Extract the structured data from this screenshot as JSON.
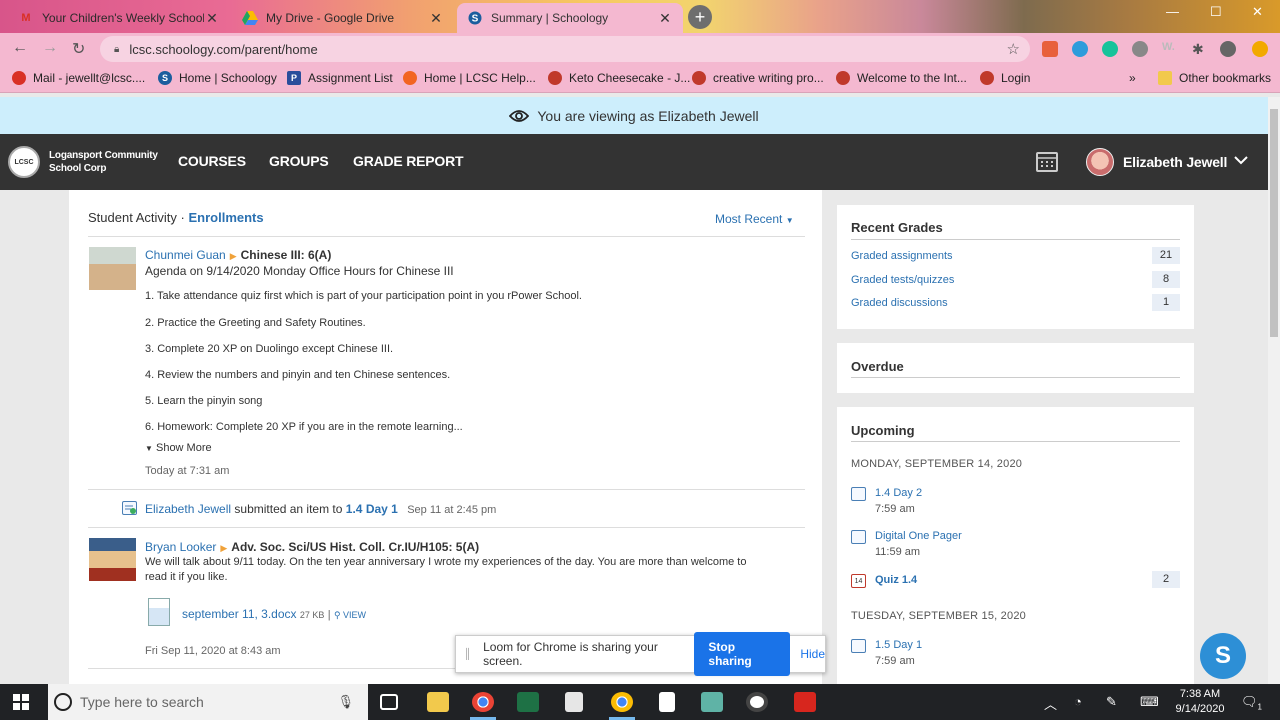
{
  "browser": {
    "tabs": [
      {
        "title": "Your Children's Weekly Schooloc",
        "active": false
      },
      {
        "title": "My Drive - Google Drive",
        "active": false
      },
      {
        "title": "Summary | Schoology",
        "active": true
      }
    ],
    "url": "lcsc.schoology.com/parent/home",
    "bookmarks": [
      "Mail - jewellt@lcsc....",
      "Home | Schoology",
      "Assignment List",
      "Home | LCSC Help...",
      "Keto Cheesecake - J...",
      "creative writing pro...",
      "Welcome to the Int...",
      "Login",
      "Other bookmarks"
    ],
    "more_bookmarks": "»"
  },
  "masquerade": {
    "text": "You are viewing as Elizabeth Jewell"
  },
  "header": {
    "org_line1": "Logansport Community",
    "org_line2": "School Corp",
    "logo_text": "LCSC",
    "nav": [
      "COURSES",
      "GROUPS",
      "GRADE REPORT"
    ],
    "user": "Elizabeth Jewell"
  },
  "activity": {
    "title": "Student Activity",
    "separator": "·",
    "enrollments": "Enrollments",
    "sort": "Most Recent",
    "post1": {
      "author": "Chunmei Guan",
      "course": "Chinese III: 6(A)",
      "subtitle": "Agenda on 9/14/2020 Monday  Office Hours for Chinese III",
      "lines": [
        "1. Take attendance quiz first which is part of your participation point in you rPower School.",
        "2. Practice the Greeting and Safety Routines.",
        "3. Complete 20 XP on Duolingo except Chinese III.",
        "4. Review the numbers and pinyin and ten Chinese sentences.",
        "5. Learn the pinyin song",
        "6. Homework: Complete 20 XP if you are in the remote learning..."
      ],
      "show_more": "Show More",
      "time": "Today at 7:31 am"
    },
    "post2": {
      "author": "Elizabeth Jewell",
      "action": "submitted an item to",
      "target": "1.4 Day 1",
      "time": "Sep 11 at 2:45 pm"
    },
    "post3": {
      "author": "Bryan Looker",
      "course": "Adv. Soc. Sci/US Hist. Coll. Cr.IU/H105: 5(A)",
      "body1": "We will talk about 9/11 today. On the ten year anniversary I wrote my experiences of the day. You are more than welcome to",
      "body2": "read it if you like.",
      "file_name": "september 11, 3.docx",
      "file_size": "27 KB",
      "view": "VIEW",
      "time": "Fri Sep 11, 2020 at 8:43 am"
    }
  },
  "recent_grades": {
    "title": "Recent Grades",
    "rows": [
      {
        "label": "Graded assignments",
        "count": "21"
      },
      {
        "label": "Graded tests/quizzes",
        "count": "8"
      },
      {
        "label": "Graded discussions",
        "count": "1"
      }
    ]
  },
  "overdue": {
    "title": "Overdue"
  },
  "upcoming": {
    "title": "Upcoming",
    "day1": "MONDAY, SEPTEMBER 14, 2020",
    "items1": [
      {
        "name": "1.4 Day 2",
        "time": "7:59 am"
      },
      {
        "name": "Digital One Pager",
        "time": "11:59 am"
      },
      {
        "name": "Quiz 1.4",
        "count": "2",
        "cal_day": "14"
      }
    ],
    "day2": "TUESDAY, SEPTEMBER 15, 2020",
    "items2": [
      {
        "name": "1.5 Day 1",
        "time": "7:59 am"
      }
    ]
  },
  "loom": {
    "message": "Loom for Chrome is sharing your screen.",
    "stop": "Stop sharing",
    "hide": "Hide"
  },
  "help_bubble": "S",
  "taskbar": {
    "search_placeholder": "Type here to search",
    "time": "7:38 AM",
    "date": "9/14/2020",
    "notif_count": "1"
  },
  "colors": {
    "link": "#2b71b1",
    "header_bg": "#333333",
    "banner_bg": "#cdeefc",
    "tab_active": "#f4b8d0"
  }
}
